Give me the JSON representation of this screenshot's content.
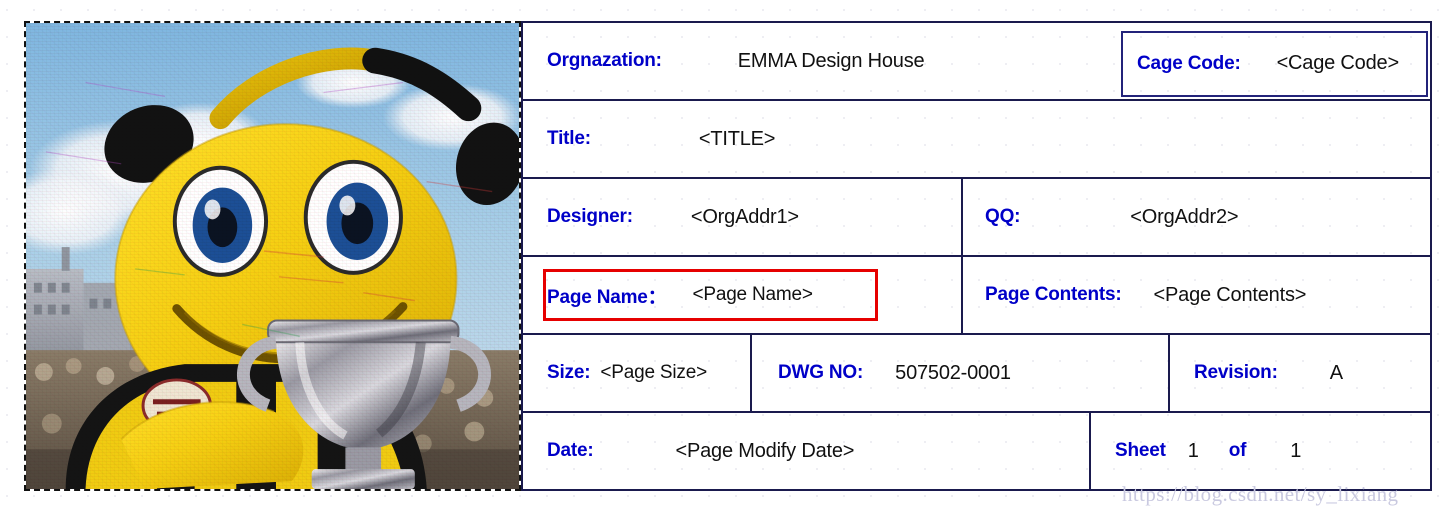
{
  "photo": {
    "alt_name": "bee-mascot-photo",
    "description": "Yellow bee mascot costume holding a silver trophy, sky and crowd background",
    "selected": true,
    "selection_border": "dashed"
  },
  "titleblock": {
    "rows": [
      {
        "name": "organization-row",
        "cells": [
          {
            "label": "Orgnazation:",
            "value": "EMMA Design House"
          },
          {
            "label": "Cage Code:",
            "value": "<Cage Code>",
            "boxed": true
          }
        ]
      },
      {
        "name": "title-row",
        "cells": [
          {
            "label": "Title:",
            "value": "<TITLE>"
          }
        ]
      },
      {
        "name": "designer-row",
        "cells": [
          {
            "label": "Designer:",
            "value": "<OrgAddr1>"
          },
          {
            "label": "QQ:",
            "value": "<OrgAddr2>"
          }
        ]
      },
      {
        "name": "pagename-row",
        "cells": [
          {
            "label": "Page Name：",
            "value": "<Page Name>",
            "highlighted": true
          },
          {
            "label": "Page Contents:",
            "value": "<Page Contents>"
          }
        ]
      },
      {
        "name": "size-row",
        "cells": [
          {
            "label": "Size:",
            "value": "<Page Size>"
          },
          {
            "label": "DWG NO:",
            "value": "507502-0001"
          },
          {
            "label": "Revision:",
            "value": "A"
          }
        ]
      },
      {
        "name": "date-row",
        "cells": [
          {
            "label": "Date:",
            "value": "<Page Modify Date>"
          },
          {
            "label": "Sheet",
            "value": "1",
            "label2": "of",
            "value2": "1"
          }
        ]
      }
    ]
  },
  "watermark": {
    "text": "https://blog.csdn.net/sy_lixiang"
  },
  "colors": {
    "label_blue": "#0000c8",
    "border_navy": "#1a1a4e",
    "highlight_red": "#e60000",
    "value_black": "#111111",
    "watermark": "#c9c9e0"
  }
}
